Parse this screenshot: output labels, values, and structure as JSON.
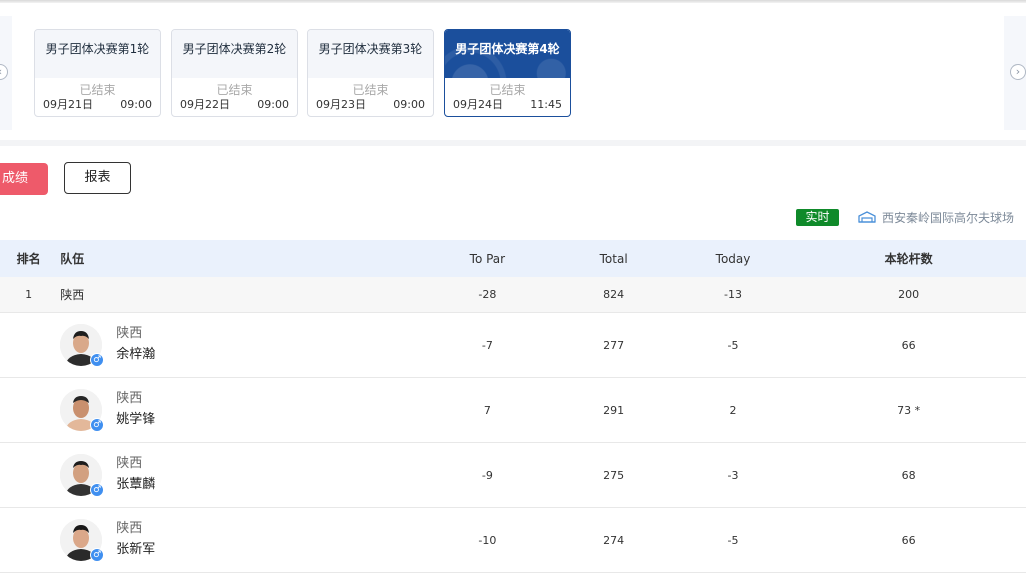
{
  "rounds": [
    {
      "title": "男子团体决赛第1轮",
      "status": "已结束",
      "date": "09月21日",
      "time": "09:00",
      "active": false
    },
    {
      "title": "男子团体决赛第2轮",
      "status": "已结束",
      "date": "09月22日",
      "time": "09:00",
      "active": false
    },
    {
      "title": "男子团体决赛第3轮",
      "status": "已结束",
      "date": "09月23日",
      "time": "09:00",
      "active": false
    },
    {
      "title": "男子团体决赛第4轮",
      "status": "已结束",
      "date": "09月24日",
      "time": "11:45",
      "active": true
    }
  ],
  "tabs": {
    "score": "成绩",
    "report": "报表"
  },
  "live_badge": "实时",
  "venue": {
    "name": "西安秦岭国际高尔夫球场",
    "icon": "stadium-icon"
  },
  "table": {
    "headers": {
      "rank": "排名",
      "team": "队伍",
      "to_par": "To Par",
      "total": "Total",
      "today": "Today",
      "strokes": "本轮杆数"
    },
    "team_row": {
      "rank": "1",
      "team": "陕西",
      "to_par": "-28",
      "total": "824",
      "today": "-13",
      "strokes": "200"
    },
    "players": [
      {
        "team": "陕西",
        "name": "余梓瀚",
        "to_par": "-7",
        "total": "277",
        "today": "-5",
        "strokes": "66",
        "gender_icon": "male-icon"
      },
      {
        "team": "陕西",
        "name": "姚学锋",
        "to_par": "7",
        "total": "291",
        "today": "2",
        "strokes": "73 *",
        "gender_icon": "male-icon"
      },
      {
        "team": "陕西",
        "name": "张蕈麟",
        "to_par": "-9",
        "total": "275",
        "today": "-3",
        "strokes": "68",
        "gender_icon": "male-icon"
      },
      {
        "team": "陕西",
        "name": "张新军",
        "to_par": "-10",
        "total": "274",
        "today": "-5",
        "strokes": "66",
        "gender_icon": "male-icon"
      }
    ]
  },
  "colors": {
    "active_round": "#1b4f9c",
    "score_tab": "#ee5a6a",
    "live_badge": "#0f8a2a",
    "header_bg": "#eaf1fc",
    "gender_badge": "#3f8ff0"
  }
}
